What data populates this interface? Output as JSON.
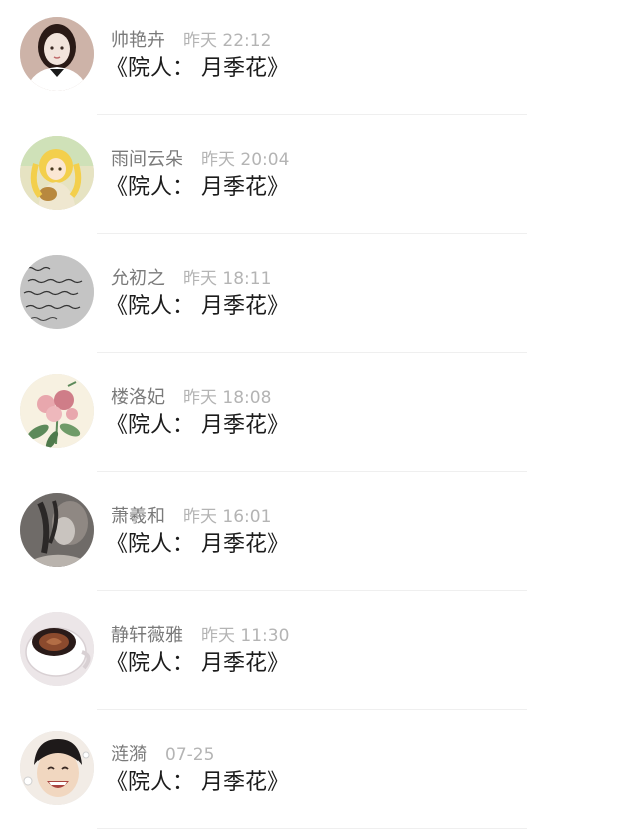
{
  "comments": [
    {
      "name": "帅艳卉",
      "time": "昨天 22:12",
      "text": "《院人： 月季花》",
      "avatar": "girl-photo-avatar-icon",
      "avatar_colors": [
        "#c9aaa0",
        "#f2e4dc",
        "#2a1a16",
        "#e9d1c5"
      ]
    },
    {
      "name": "雨间云朵",
      "time": "昨天 20:04",
      "text": "《院人： 月季花》",
      "avatar": "anime-girl-avatar-icon",
      "avatar_colors": [
        "#e6e3c2",
        "#f3cf4c",
        "#efe7d0",
        "#b8883e"
      ]
    },
    {
      "name": "允初之",
      "time": "昨天 18:11",
      "text": "《院人： 月季花》",
      "avatar": "handwriting-avatar-icon",
      "avatar_colors": [
        "#bdbdbd",
        "#d0d0d0",
        "#333333",
        "#a8a8a8"
      ]
    },
    {
      "name": "楼洛妃",
      "time": "昨天 18:08",
      "text": "《院人： 月季花》",
      "avatar": "flower-avatar-icon",
      "avatar_colors": [
        "#f7f1e1",
        "#e8a7ad",
        "#5d8a5a",
        "#cf7d88"
      ]
    },
    {
      "name": "萧羲和",
      "time": "昨天 16:01",
      "text": "《院人： 月季花》",
      "avatar": "ink-art-avatar-icon",
      "avatar_colors": [
        "#6f6b68",
        "#c9c4bf",
        "#2b2827",
        "#8f8883"
      ]
    },
    {
      "name": "静轩薇雅",
      "time": "昨天 11:30",
      "text": "《院人： 月季花》",
      "avatar": "coffee-cup-avatar-icon",
      "avatar_colors": [
        "#ece6e8",
        "#ffffff",
        "#8b4a2d",
        "#2a1b19"
      ]
    },
    {
      "name": "涟漪",
      "time": "07-25",
      "text": "《院人： 月季花》",
      "avatar": "smiling-boy-avatar-icon",
      "avatar_colors": [
        "#f2ece6",
        "#f1d7c0",
        "#1e1a1a",
        "#ffffff"
      ]
    }
  ]
}
